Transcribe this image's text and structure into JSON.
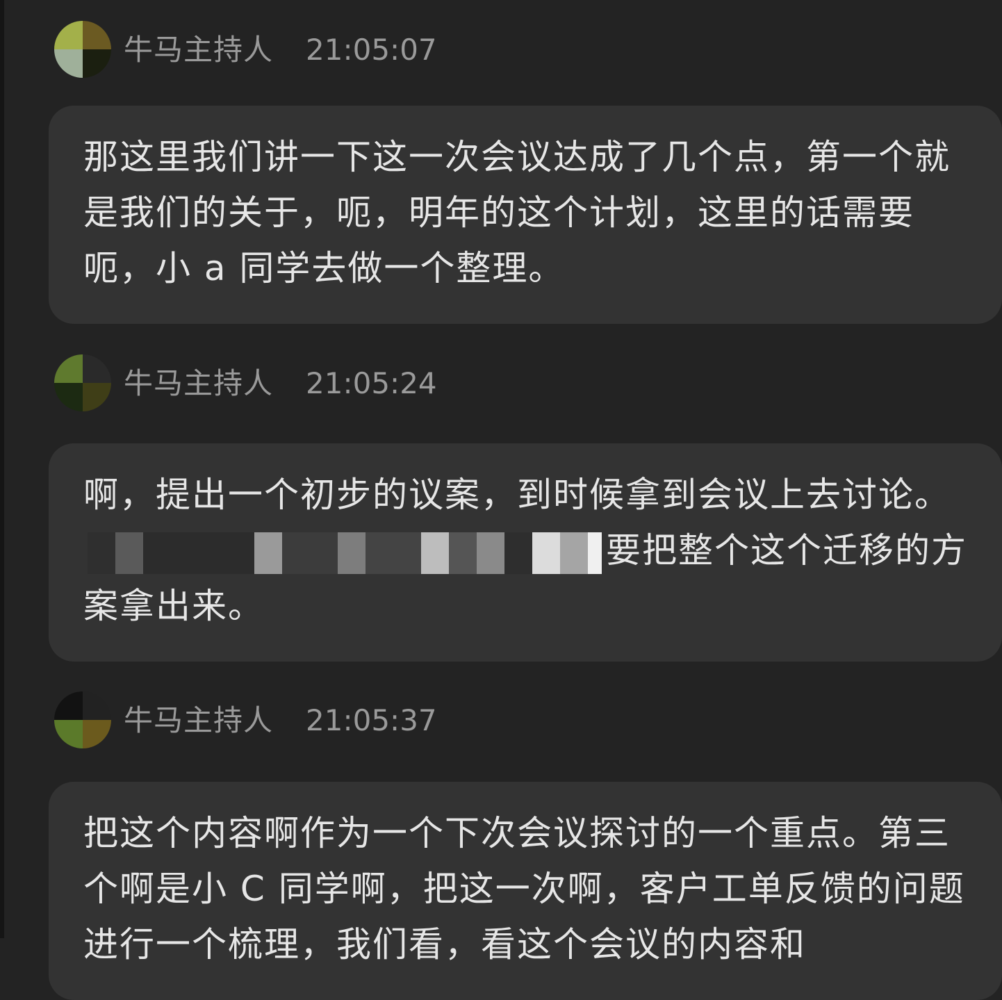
{
  "messages": [
    {
      "sender": "牛马主持人",
      "time": "21:05:07",
      "avatar_colors": [
        "#a3b04a",
        "#6b5a22",
        "#9fb09a",
        "#1b1f10"
      ],
      "text": "那这里我们讲一下这一次会议达成了几个点，第一个就是我们的关于，呃，明年的这个计划，这里的话需要呃，小 a 同学去做一个整理。"
    },
    {
      "sender": "牛马主持人",
      "time": "21:05:24",
      "avatar_colors": [
        "#5f7a2e",
        "#2a2a2a",
        "#1c2a12",
        "#3f3e17"
      ],
      "text_before": "啊，提出一个初步的议案，到时候拿到会议上去讨论。",
      "text_after": "要把整个这个迁移的方案拿出来。"
    },
    {
      "sender": "牛马主持人",
      "time": "21:05:37",
      "avatar_colors": [
        "#121212",
        "#222222",
        "#5b7a2a",
        "#6b5a1d"
      ],
      "text": "把这个内容啊作为一个下次会议探讨的一个重点。第三个啊是小 C 同学啊，把这一次啊，客户工单反馈的问题进行一个梳理，我们看，看这个会议的内容和"
    }
  ]
}
